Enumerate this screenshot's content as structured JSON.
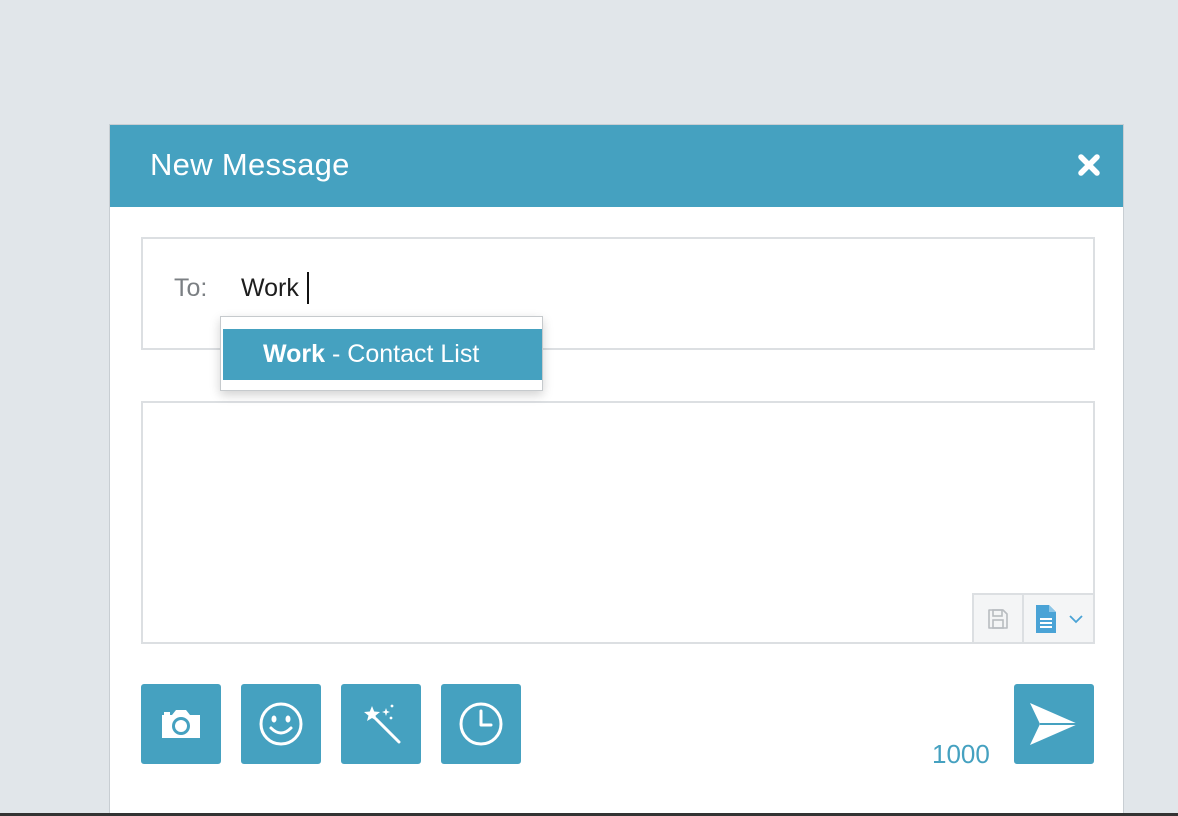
{
  "dialog": {
    "title": "New Message"
  },
  "to": {
    "label": "To:",
    "value": "Work"
  },
  "suggestion": {
    "name": "Work",
    "suffix": " - Contact List"
  },
  "message": {
    "char_count": "1000"
  },
  "icons": {
    "close": "close-icon",
    "save": "save-icon",
    "template": "document-icon",
    "dropdown": "chevron-down-icon",
    "camera": "camera-icon",
    "emoji": "smiley-icon",
    "magic": "magic-wand-icon",
    "schedule": "clock-icon",
    "send": "send-icon"
  },
  "colors": {
    "accent": "#45a1c0",
    "background": "#e1e6ea",
    "border": "#dcdfe2"
  }
}
